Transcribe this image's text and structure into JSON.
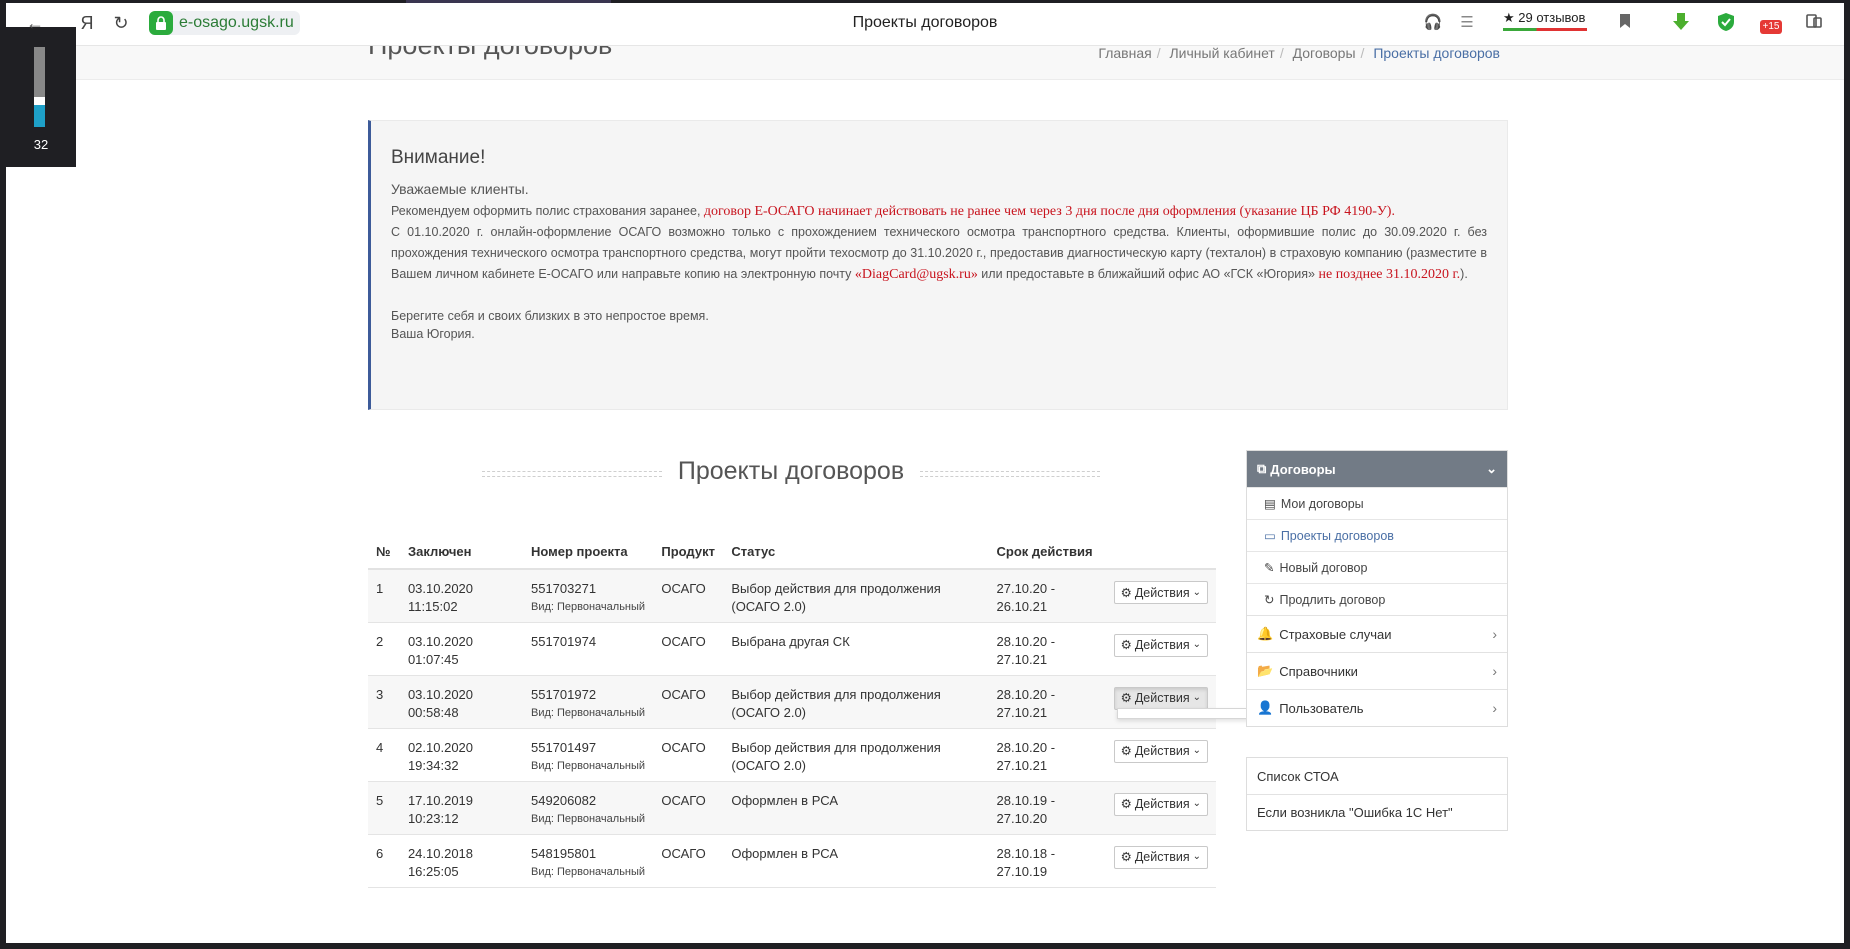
{
  "browser": {
    "address": "e-osago.ugsk.ru",
    "tab_title": "Проекты договоров",
    "reviews": "★ 29 отзывов",
    "badge": "+15",
    "zoom_value": "32"
  },
  "page": {
    "title": "Проекты договоров",
    "breadcrumbs": [
      "Главная",
      "Личный кабинет",
      "Договоры",
      "Проекты договоров"
    ]
  },
  "notice": {
    "heading": "Внимание!",
    "greeting": "Уважаемые клиенты.",
    "p1_a": "Рекомендуем оформить полис страхования заранее, ",
    "p1_red": "договор Е-ОСАГО начинает действовать не ранее чем через 3 дня после дня оформления (указание ЦБ РФ 4190-У).",
    "p2_a": "С 01.10.2020 г. онлайн-оформление ОСАГО возможно только с прохождением технического осмотра транспортного средства. Клиенты, оформившие полис до 30.09.2020 г. без прохождения технического осмотра транспортного средства, могут пройти техосмотр до 31.10.2020 г., предоставив диагностическую карту (техталон) в страховую компанию (разместите в Вашем личном кабинете Е-ОСАГО или направьте копию на электронную почту ",
    "p2_email": "«DiagCard@ugsk.ru»",
    "p2_b": " или предоставьте в ближайший офис АО «ГСК «Югория» ",
    "p2_red": "не позднее 31.10.2020 г.",
    "p2_end": ").",
    "bye1": "Берегите себя и своих близких в это непростое время.",
    "bye2": "Ваша Югория."
  },
  "section_title": "Проекты договоров",
  "table": {
    "headers": [
      "№",
      "Заключен",
      "Номер проекта",
      "Продукт",
      "Статус",
      "Срок действия",
      ""
    ],
    "action_label": "Действия",
    "rows": [
      {
        "n": "1",
        "date": "03.10.2020",
        "time": "11:15:02",
        "num": "551703271",
        "kind": "Вид: Первоначальный",
        "product": "ОСАГО",
        "status1": "Выбор действия для продолжения",
        "status2": "(ОСАГО 2.0)",
        "from": "27.10.20 -",
        "to": "26.10.21"
      },
      {
        "n": "2",
        "date": "03.10.2020",
        "time": "01:07:45",
        "num": "551701974",
        "kind": "",
        "product": "ОСАГО",
        "status1": "Выбрана другая СК",
        "status2": "",
        "from": "28.10.20 -",
        "to": "27.10.21"
      },
      {
        "n": "3",
        "date": "03.10.2020",
        "time": "00:58:48",
        "num": "551701972",
        "kind": "Вид: Первоначальный",
        "product": "ОСАГО",
        "status1": "Выбор действия для продолжения",
        "status2": "(ОСАГО 2.0)",
        "from": "28.10.20 -",
        "to": "27.10.21"
      },
      {
        "n": "4",
        "date": "02.10.2020",
        "time": "19:34:32",
        "num": "551701497",
        "kind": "Вид: Первоначальный",
        "product": "ОСАГО",
        "status1": "Выбор действия для продолжения",
        "status2": "(ОСАГО 2.0)",
        "from": "28.10.20 -",
        "to": "27.10.21"
      },
      {
        "n": "5",
        "date": "17.10.2019",
        "time": "10:23:12",
        "num": "549206082",
        "kind": "Вид: Первоначальный",
        "product": "ОСАГО",
        "status1": "Оформлен в РСА",
        "status2": "",
        "from": "28.10.19 -",
        "to": "27.10.20"
      },
      {
        "n": "6",
        "date": "24.10.2018",
        "time": "16:25:05",
        "num": "548195801",
        "kind": "Вид: Первоначальный",
        "product": "ОСАГО",
        "status1": "Оформлен в РСА",
        "status2": "",
        "from": "28.10.18 -",
        "to": "27.10.19"
      }
    ]
  },
  "sidebar": {
    "head": "Договоры",
    "subs": [
      "Мои договоры",
      "Проекты договоров",
      "Новый договор",
      "Продлить договор"
    ],
    "groups": [
      "Страховые случаи",
      "Справочники",
      "Пользователь"
    ],
    "links": [
      "Список СТОА",
      "Если возникла \"Ошибка 1С Нет\""
    ]
  }
}
